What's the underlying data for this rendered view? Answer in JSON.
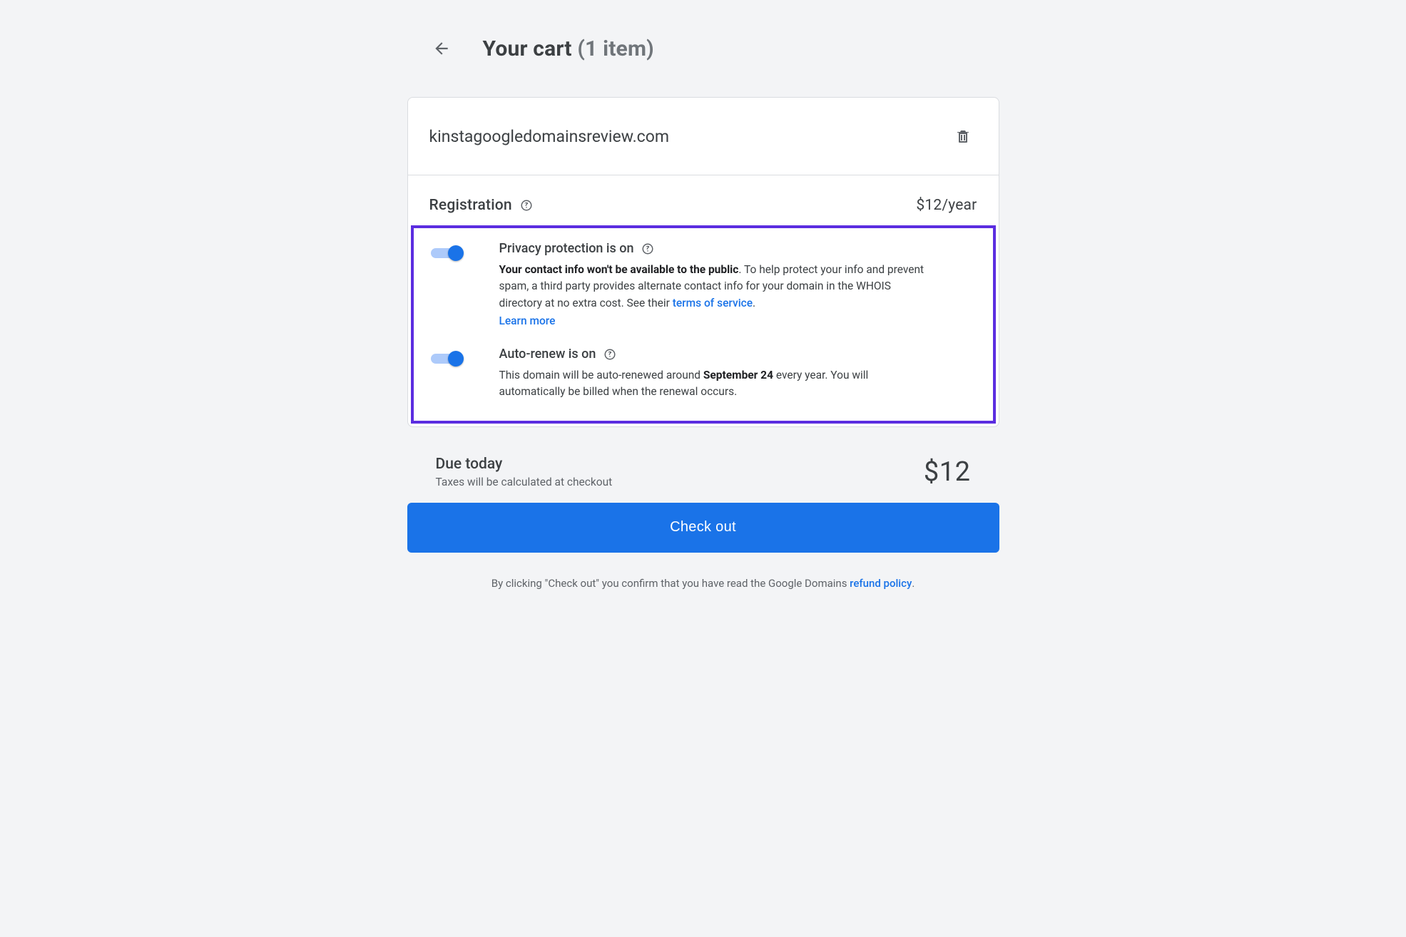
{
  "header": {
    "title": "Your cart",
    "count_text": "(1 item)"
  },
  "cart": {
    "domain": "kinstagoogledomainsreview.com",
    "registration_label": "Registration",
    "price": "$12/year"
  },
  "privacy": {
    "title": "Privacy protection is on",
    "desc_bold": "Your contact info won't be available to the public",
    "desc_rest": ". To help protect your info and prevent spam, a third party provides alternate contact info for your domain in the WHOIS directory at no extra cost. See their ",
    "tos_link": "terms of service",
    "period": ".",
    "learn_more": "Learn more"
  },
  "autorenew": {
    "title": "Auto-renew is on",
    "desc_pre": "This domain will be auto-renewed around ",
    "date": "September 24",
    "desc_post": " every year. You will automatically be billed when the renewal occurs."
  },
  "due": {
    "title": "Due today",
    "subtitle": "Taxes will be calculated at checkout",
    "amount": "$12"
  },
  "checkout_label": "Check out",
  "disclaimer": {
    "pre": "By clicking \"Check out\" you confirm that you have read the Google Domains ",
    "link": "refund policy",
    "post": "."
  }
}
